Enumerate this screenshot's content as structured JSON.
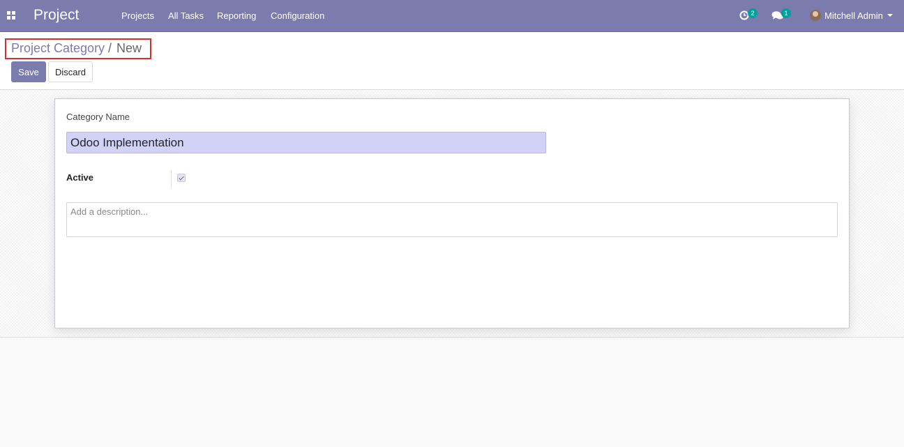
{
  "navbar": {
    "brand": "Project",
    "menu": [
      "Projects",
      "All Tasks",
      "Reporting",
      "Configuration"
    ],
    "activity_count": "2",
    "messages_count": "1",
    "user": "Mitchell Admin",
    "icons": [
      "apps-grid-icon",
      "activity-clock-icon",
      "chat-bubbles-icon",
      "user-avatar",
      "dropdown-caret-icon"
    ],
    "color": "#7c7bad"
  },
  "breadcrumb": {
    "parent": "Project Category",
    "separator": "/",
    "current": "New"
  },
  "buttons": {
    "save": "Save",
    "discard": "Discard"
  },
  "form": {
    "category_name_label": "Category Name",
    "category_name_value": "Odoo Implementation",
    "active_label": "Active",
    "active_checked": true,
    "description_placeholder": "Add a description..."
  },
  "colors": {
    "accent": "#7c7bad",
    "input_highlight": "#d2d2f7",
    "breadcrumb_highlight_border": "#d32f2f",
    "badge": "#00a09d"
  }
}
